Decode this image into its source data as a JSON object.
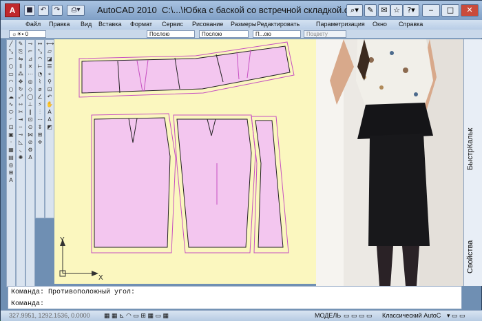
{
  "window": {
    "app_name": "AutoCAD 2010",
    "file_title": "C:\\...\\Юбка с баской со встречной складкой.dwg"
  },
  "menu": [
    "Файл",
    "Правка",
    "Вид",
    "Вставка",
    "Формат",
    "Сервис",
    "Рисование",
    "Размеры",
    "Редактировать",
    "Параметризация",
    "Окно",
    "Справка"
  ],
  "layer_toolbar": {
    "color_control": "Послою",
    "linetype_control": "Послою",
    "lineweight_control": "П...ою",
    "plotstyle_control": "Поцвету"
  },
  "right_panel": {
    "tab_quickcalc": "БыстрКальк",
    "tab_properties": "Свойства"
  },
  "ucs": {
    "y_label": "Y",
    "x_label": "X"
  },
  "command": {
    "history_line": "Команда: Противоположный угол:",
    "prompt": "Команда:"
  },
  "status": {
    "coordinates": "327.9951, 1292.1536, 0.0000",
    "model_label": "МОДЕЛЬ",
    "workspace": "Классический AutoC"
  }
}
